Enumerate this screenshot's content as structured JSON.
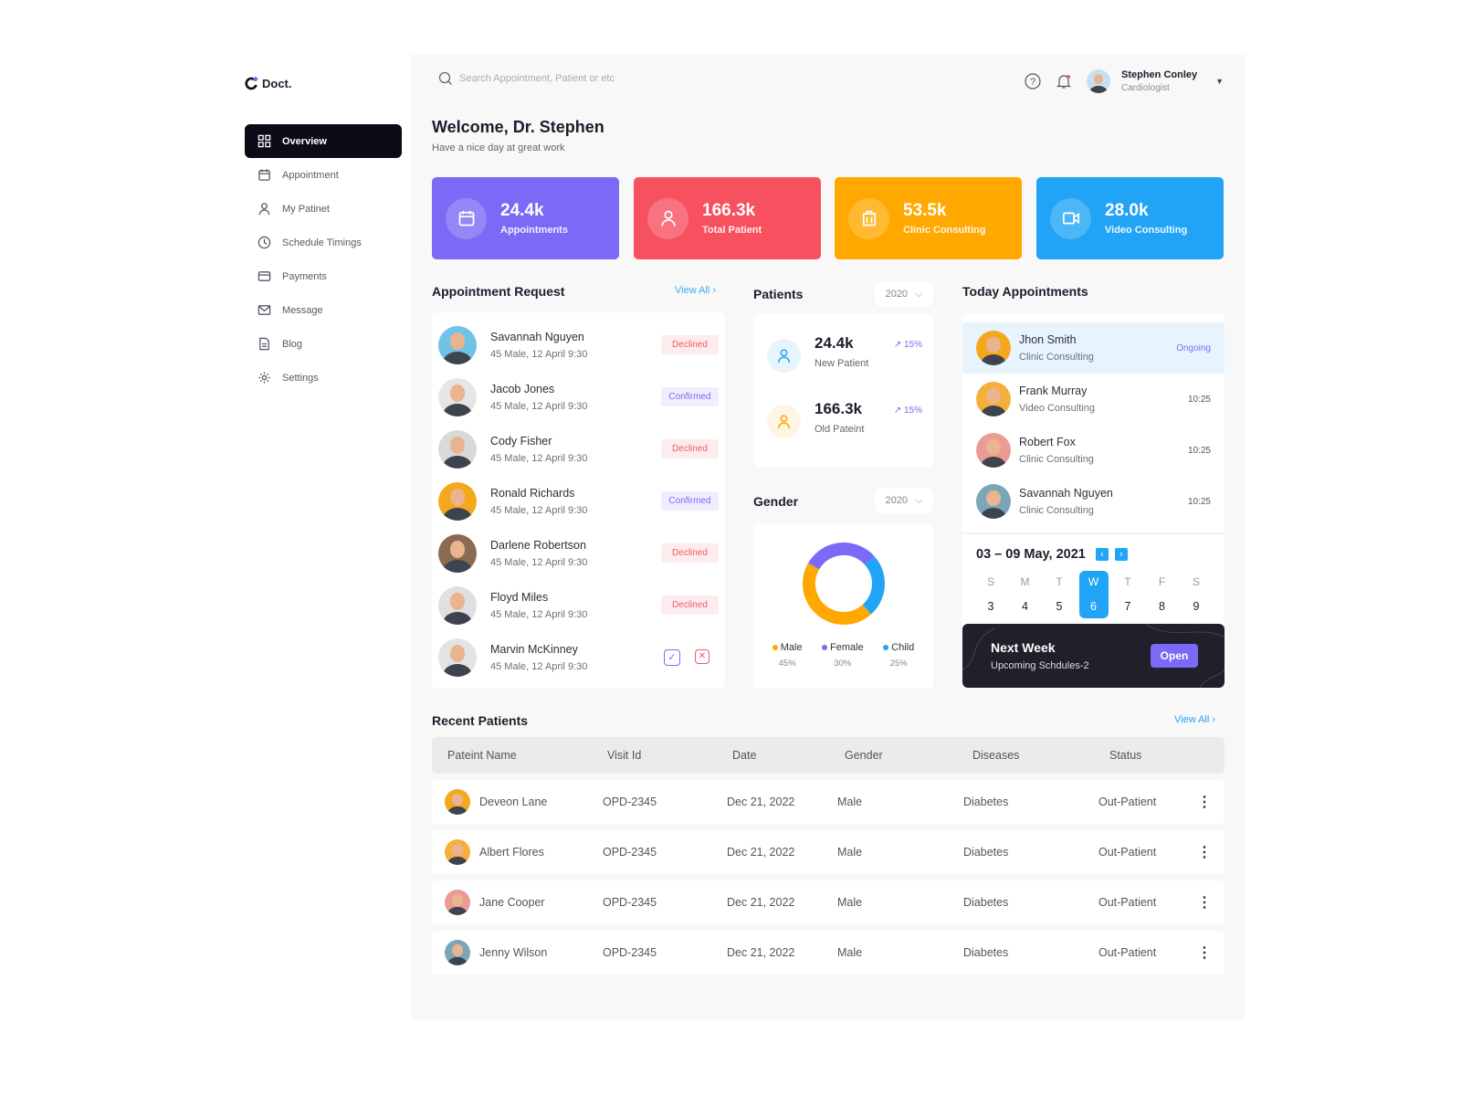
{
  "brand": "Doct.",
  "accent": "#7a6af5",
  "sidebar": {
    "items": [
      {
        "label": "Overview",
        "icon": "grid-icon"
      },
      {
        "label": "Appointment",
        "icon": "calendar-icon"
      },
      {
        "label": "My Patinet",
        "icon": "user-icon"
      },
      {
        "label": "Schedule Timings",
        "icon": "clock-icon"
      },
      {
        "label": "Payments",
        "icon": "card-icon"
      },
      {
        "label": "Message",
        "icon": "mail-icon"
      },
      {
        "label": "Blog",
        "icon": "document-icon"
      },
      {
        "label": "Settings",
        "icon": "gear-icon"
      }
    ]
  },
  "header": {
    "search_placeholder": "Search Appointment, Patient or etc",
    "user_name": "Stephen Conley",
    "user_role": "Cardiologist"
  },
  "welcome": {
    "title": "Welcome, Dr. Stephen",
    "subtitle": "Have a nice day at great work"
  },
  "stats": [
    {
      "value": "24.4k",
      "label": "Appointments",
      "color": "#7a6af5",
      "icon": "calendar-icon"
    },
    {
      "value": "166.3k",
      "label": "Total Patient",
      "color": "#f7505f",
      "icon": "user-icon"
    },
    {
      "value": "53.5k",
      "label": "Clinic Consulting",
      "color": "#ffa800",
      "icon": "building-icon"
    },
    {
      "value": "28.0k",
      "label": "Video Consulting",
      "color": "#21a4f5",
      "icon": "video-icon"
    }
  ],
  "appointment_request": {
    "title": "Appointment Request",
    "view_all": "View All",
    "items": [
      {
        "name": "Savannah Nguyen",
        "meta": "45 Male, 12 April 9:30",
        "status": "Declined"
      },
      {
        "name": "Jacob Jones",
        "meta": "45 Male, 12 April 9:30",
        "status": "Confirmed"
      },
      {
        "name": "Cody Fisher",
        "meta": "45 Male, 12 April 9:30",
        "status": "Declined"
      },
      {
        "name": "Ronald Richards",
        "meta": "45 Male, 12 April 9:30",
        "status": "Confirmed"
      },
      {
        "name": "Darlene Robertson",
        "meta": "45 Male, 12 April 9:30",
        "status": "Declined"
      },
      {
        "name": "Floyd Miles",
        "meta": "45 Male, 12 April 9:30",
        "status": "Declined"
      },
      {
        "name": "Marvin McKinney",
        "meta": "45 Male, 12 April 9:30",
        "status": ""
      }
    ]
  },
  "patients": {
    "title": "Patients",
    "year": "2020",
    "items": [
      {
        "value": "24.4k",
        "label": "New Patient",
        "change": "15%"
      },
      {
        "value": "166.3k",
        "label": "Old Pateint",
        "change": "15%"
      }
    ]
  },
  "gender": {
    "title": "Gender",
    "year": "2020",
    "segments": [
      {
        "label": "Male",
        "percent": 45,
        "percent_label": "45%",
        "color": "#ffa800"
      },
      {
        "label": "Female",
        "percent": 30,
        "percent_label": "30%",
        "color": "#7a6af5"
      },
      {
        "label": "Child",
        "percent": 25,
        "percent_label": "25%",
        "color": "#21a4f5"
      }
    ]
  },
  "today": {
    "title": "Today Appointments",
    "items": [
      {
        "name": "Jhon Smith",
        "type": "Clinic Consulting",
        "time": "Ongoing"
      },
      {
        "name": "Frank Murray",
        "type": "Video Consulting",
        "time": "10:25"
      },
      {
        "name": "Robert Fox",
        "type": "Clinic Consulting",
        "time": "10:25"
      },
      {
        "name": "Savannah Nguyen",
        "type": "Clinic Consulting",
        "time": "10:25"
      }
    ]
  },
  "calendar": {
    "range": "03 – 09 May, 2021",
    "days": [
      {
        "d": "S",
        "n": "3"
      },
      {
        "d": "M",
        "n": "4"
      },
      {
        "d": "T",
        "n": "5"
      },
      {
        "d": "W",
        "n": "6",
        "selected": true
      },
      {
        "d": "T",
        "n": "7"
      },
      {
        "d": "F",
        "n": "8"
      },
      {
        "d": "S",
        "n": "9"
      }
    ]
  },
  "next_week": {
    "title": "Next Week",
    "subtitle": "Upcoming Schdules-2",
    "button": "Open"
  },
  "recent": {
    "title": "Recent Patients",
    "view_all": "View All",
    "columns": [
      "Pateint Name",
      "Visit Id",
      "Date",
      "Gender",
      "Diseases",
      "Status"
    ],
    "rows": [
      [
        "Deveon Lane",
        "OPD-2345",
        "Dec 21, 2022",
        "Male",
        "Diabetes",
        "Out-Patient"
      ],
      [
        "Albert Flores",
        "OPD-2345",
        "Dec 21, 2022",
        "Male",
        "Diabetes",
        "Out-Patient"
      ],
      [
        "Jane Cooper",
        "OPD-2345",
        "Dec 21, 2022",
        "Male",
        "Diabetes",
        "Out-Patient"
      ],
      [
        "Jenny Wilson",
        "OPD-2345",
        "Dec 21, 2022",
        "Male",
        "Diabetes",
        "Out-Patient"
      ]
    ]
  }
}
